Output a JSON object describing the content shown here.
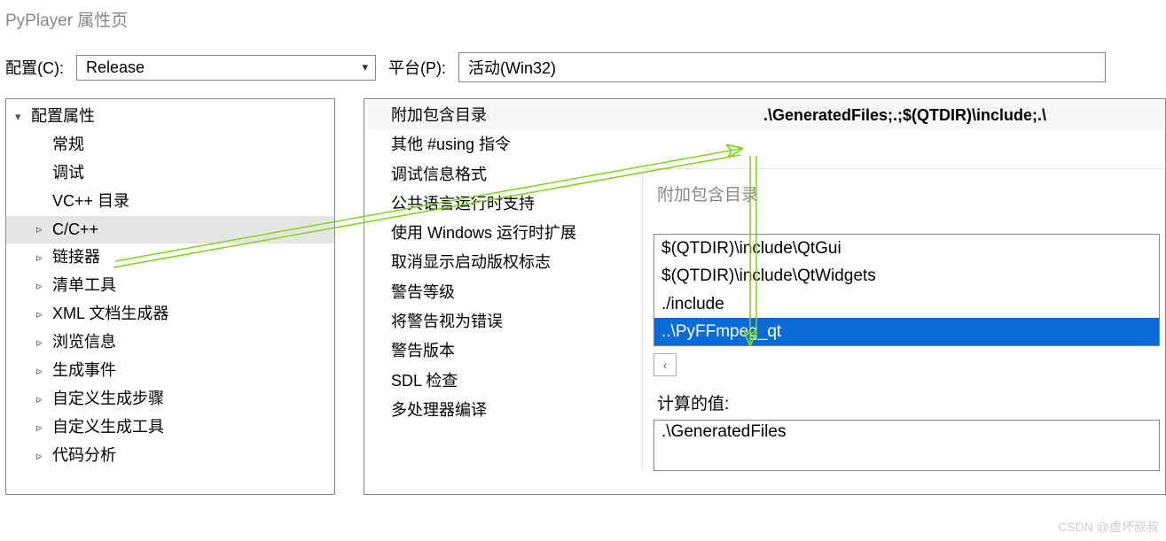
{
  "window_title": "PyPlayer 属性页",
  "config": {
    "label": "配置(C):",
    "value": "Release"
  },
  "platform": {
    "label": "平台(P):",
    "value": "活动(Win32)"
  },
  "tree": {
    "root": "配置属性",
    "items": [
      {
        "label": "常规",
        "expandable": false
      },
      {
        "label": "调试",
        "expandable": false
      },
      {
        "label": "VC++ 目录",
        "expandable": false
      },
      {
        "label": "C/C++",
        "expandable": true,
        "selected": true
      },
      {
        "label": "链接器",
        "expandable": true
      },
      {
        "label": "清单工具",
        "expandable": true
      },
      {
        "label": "XML 文档生成器",
        "expandable": true
      },
      {
        "label": "浏览信息",
        "expandable": true
      },
      {
        "label": "生成事件",
        "expandable": true
      },
      {
        "label": "自定义生成步骤",
        "expandable": true
      },
      {
        "label": "自定义生成工具",
        "expandable": true
      },
      {
        "label": "代码分析",
        "expandable": true
      }
    ]
  },
  "props": {
    "rows": [
      {
        "name": "附加包含目录",
        "value": ".\\GeneratedFiles;.;$(QTDIR)\\include;.\\",
        "selected": true
      },
      {
        "name": "其他 #using 指令",
        "value": ""
      },
      {
        "name": "调试信息格式",
        "value": ""
      },
      {
        "name": "公共语言运行时支持",
        "value": ""
      },
      {
        "name": "使用 Windows 运行时扩展",
        "value": ""
      },
      {
        "name": "取消显示启动版权标志",
        "value": ""
      },
      {
        "name": "警告等级",
        "value": ""
      },
      {
        "name": "将警告视为错误",
        "value": ""
      },
      {
        "name": "警告版本",
        "value": ""
      },
      {
        "name": "SDL 检查",
        "value": ""
      },
      {
        "name": "多处理器编译",
        "value": ""
      }
    ]
  },
  "popup": {
    "title": "附加包含目录",
    "items": [
      "$(QTDIR)\\include\\QtGui",
      "$(QTDIR)\\include\\QtWidgets",
      "./include",
      "..\\PyFFmpeg_qt"
    ],
    "highlight_index": 3,
    "computed_label": "计算的值:",
    "computed_value": ".\\GeneratedFiles"
  },
  "watermark": "CSDN @虚坏叔叔"
}
